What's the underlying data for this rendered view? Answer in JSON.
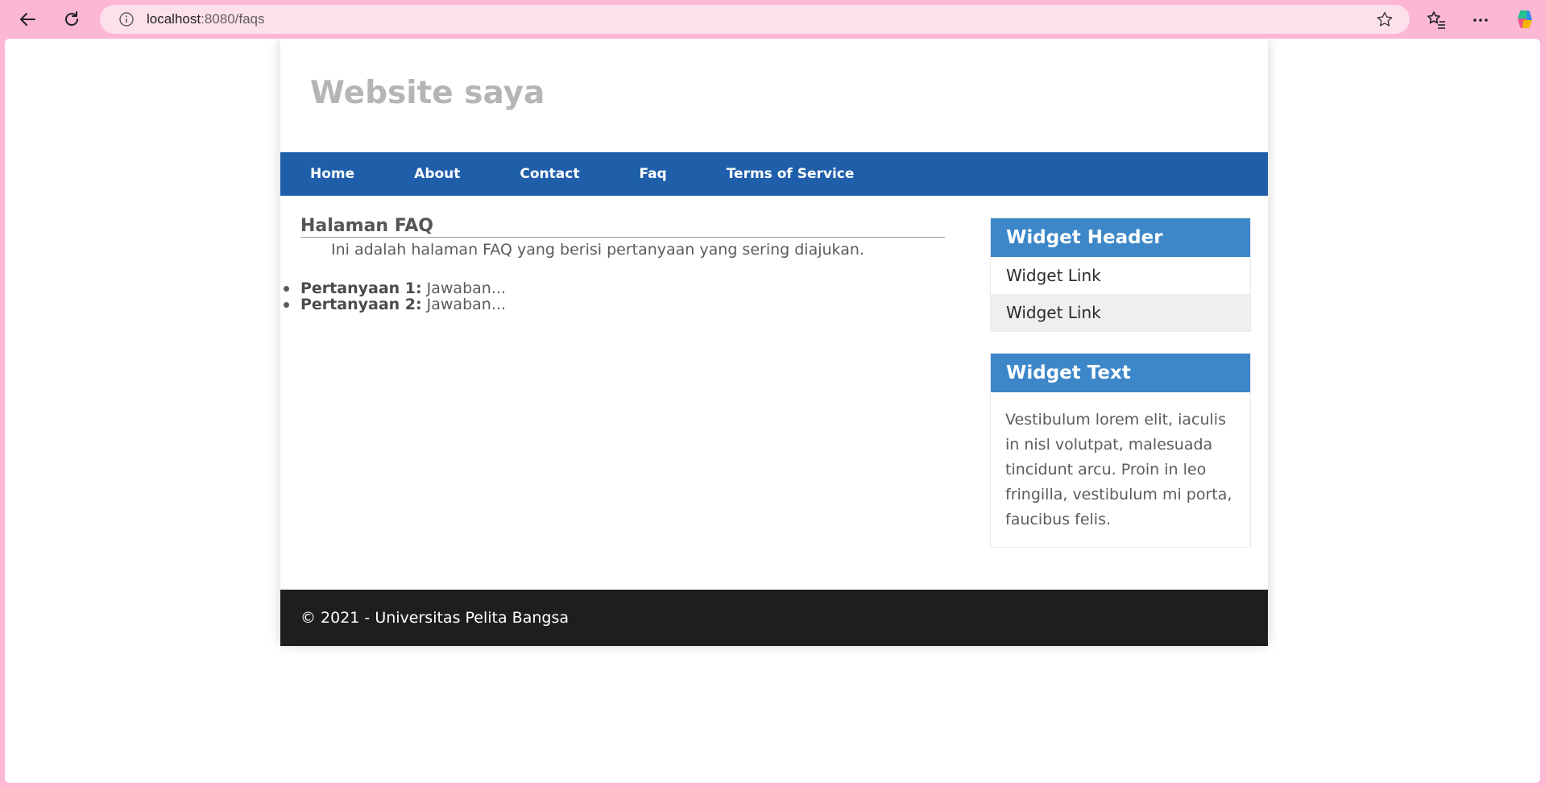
{
  "browser": {
    "url_host": "localhost",
    "url_path": ":8080/faqs",
    "icons": [
      "back-arrow-icon",
      "reload-icon",
      "info-icon",
      "star-icon",
      "favorites-icon",
      "more-icon",
      "copilot-icon"
    ]
  },
  "site": {
    "title": "Website saya"
  },
  "nav": {
    "items": [
      {
        "label": "Home"
      },
      {
        "label": "About"
      },
      {
        "label": "Contact"
      },
      {
        "label": "Faq"
      },
      {
        "label": "Terms of Service"
      }
    ]
  },
  "content": {
    "heading": "Halaman FAQ",
    "intro": "Ini adalah halaman FAQ yang berisi pertanyaan yang sering diajukan.",
    "faqs": [
      {
        "question": "Pertanyaan 1:",
        "answer": " Jawaban..."
      },
      {
        "question": "Pertanyaan 2:",
        "answer": " Jawaban..."
      }
    ]
  },
  "sidebar": {
    "widget_links": {
      "header": "Widget Header",
      "links": [
        {
          "label": "Widget Link"
        },
        {
          "label": "Widget Link"
        }
      ]
    },
    "widget_text": {
      "header": "Widget Text",
      "body": "Vestibulum lorem elit, iaculis in nisl volutpat, malesuada tincidunt arcu. Proin in leo fringilla, vestibulum mi porta, faucibus felis."
    }
  },
  "footer": {
    "text": "© 2021 - Universitas Pelita Bangsa"
  },
  "colors": {
    "browser_frame": "#fbb7d3",
    "nav_bar": "#1f5faa",
    "widget_header": "#3d87c9",
    "footer": "#1e1e1e"
  }
}
